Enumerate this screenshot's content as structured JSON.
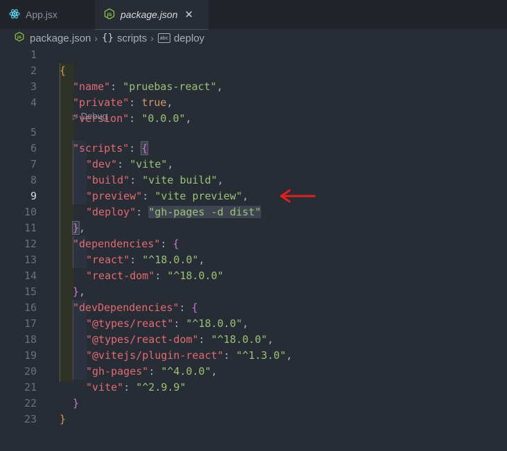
{
  "tabs": [
    {
      "label": "App.jsx",
      "icon": "react-icon",
      "active": false
    },
    {
      "label": "package.json",
      "icon": "json-icon",
      "active": true,
      "close": "✕"
    }
  ],
  "breadcrumb": {
    "file": "package.json",
    "scripts": "scripts",
    "deploy": "deploy",
    "braces_glyph": "{}",
    "abc_glyph": "abc"
  },
  "editor": {
    "active_line": 9,
    "codelens": "Debug",
    "lines": [
      {
        "n": "1"
      },
      {
        "n": "2"
      },
      {
        "n": "3"
      },
      {
        "n": "4"
      },
      {
        "n": "5"
      },
      {
        "n": "6"
      },
      {
        "n": "7"
      },
      {
        "n": "8"
      },
      {
        "n": "9"
      },
      {
        "n": "10"
      },
      {
        "n": "11"
      },
      {
        "n": "12"
      },
      {
        "n": "13"
      },
      {
        "n": "14"
      },
      {
        "n": "15"
      },
      {
        "n": "16"
      },
      {
        "n": "17"
      },
      {
        "n": "18"
      },
      {
        "n": "19"
      },
      {
        "n": "20"
      },
      {
        "n": "21"
      },
      {
        "n": "22"
      },
      {
        "n": "23"
      }
    ],
    "code": {
      "open_brace": "{",
      "name_key": "\"name\"",
      "name_val": "\"pruebas-react\"",
      "private_key": "\"private\"",
      "private_val": "true",
      "version_key": "\"version\"",
      "version_val": "\"0.0.0\"",
      "scripts_key": "\"scripts\"",
      "dev_key": "\"dev\"",
      "dev_val": "\"vite\"",
      "build_key": "\"build\"",
      "build_val": "\"vite build\"",
      "preview_key": "\"preview\"",
      "preview_val": "\"vite preview\"",
      "deploy_key": "\"deploy\"",
      "deploy_val": "\"gh-pages -d dist\"",
      "dependencies_key": "\"dependencies\"",
      "react_key": "\"react\"",
      "react_val": "\"^18.0.0\"",
      "react_dom_key": "\"react-dom\"",
      "react_dom_val": "\"^18.0.0\"",
      "devdeps_key": "\"devDependencies\"",
      "types_react_key": "\"@types/react\"",
      "types_react_val": "\"^18.0.0\"",
      "types_react_dom_key": "\"@types/react-dom\"",
      "types_react_dom_val": "\"^18.0.0\"",
      "plugin_react_key": "\"@vitejs/plugin-react\"",
      "plugin_react_val": "\"^1.3.0\"",
      "gh_pages_key": "\"gh-pages\"",
      "gh_pages_val": "\"^4.0.0\"",
      "vite_key": "\"vite\"",
      "vite_val": "\"^2.9.9\"",
      "close_brace": "}"
    }
  },
  "colors": {
    "background": "#282c34",
    "key": "#e06c75",
    "string": "#98c379",
    "boolean": "#d19a66",
    "annotation_arrow": "#e02020"
  }
}
